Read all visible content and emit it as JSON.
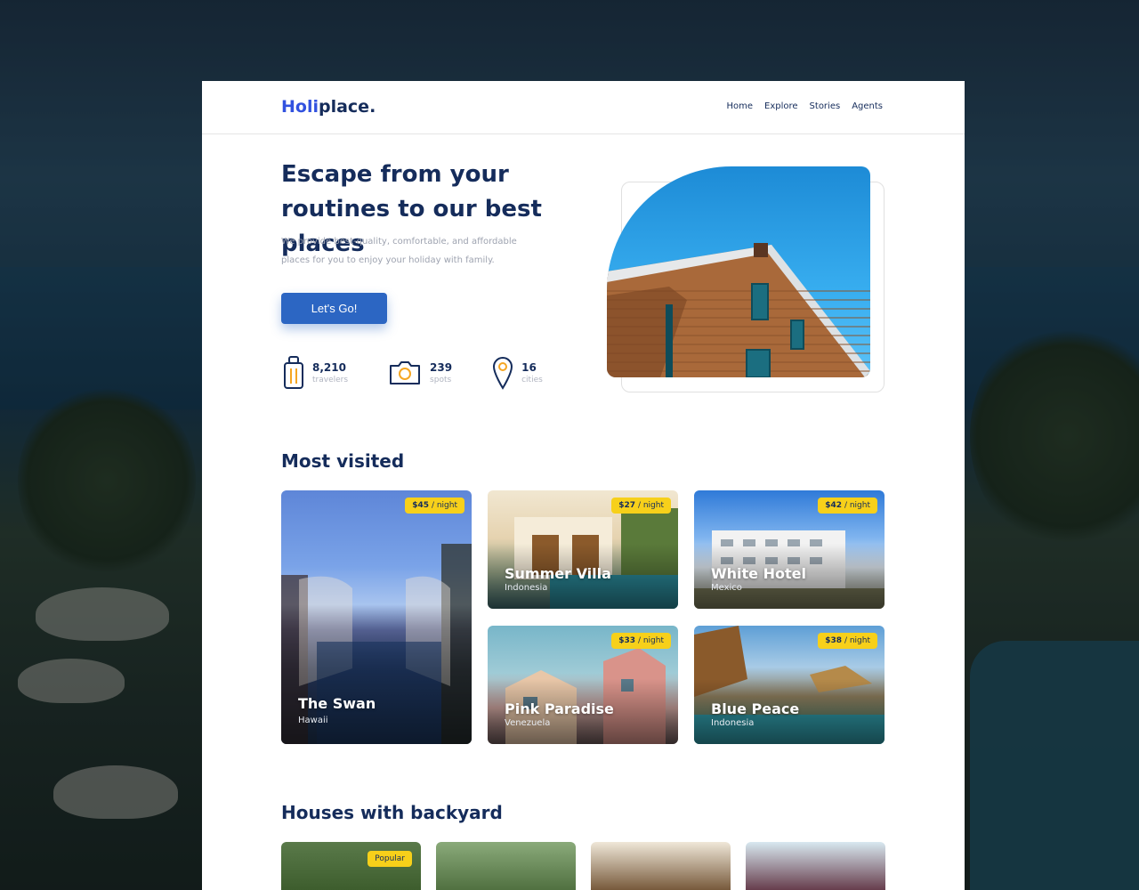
{
  "brand": {
    "name_part1": "Holi",
    "name_part2": "place."
  },
  "nav": {
    "items": [
      "Home",
      "Explore",
      "Stories",
      "Agents"
    ]
  },
  "hero": {
    "title": "Escape from your routines to our best places",
    "subtitle": "We provide best-quality, comfortable, and affordable places for you to enjoy your holiday with family.",
    "cta_label": "Let's Go!",
    "stats": [
      {
        "icon": "suitcase-icon",
        "value": "8,210",
        "label": "travelers"
      },
      {
        "icon": "camera-icon",
        "value": "239",
        "label": "spots"
      },
      {
        "icon": "map-pin-icon",
        "value": "16",
        "label": "cities"
      }
    ]
  },
  "most_visited": {
    "title": "Most visited",
    "cards": [
      {
        "name": "The Swan",
        "location": "Hawaii",
        "price": "$45",
        "unit": "/ night"
      },
      {
        "name": "Summer Villa",
        "location": "Indonesia",
        "price": "$27",
        "unit": "/ night"
      },
      {
        "name": "White Hotel",
        "location": "Mexico",
        "price": "$42",
        "unit": "/ night"
      },
      {
        "name": "Pink Paradise",
        "location": "Venezuela",
        "price": "$33",
        "unit": "/ night"
      },
      {
        "name": "Blue Peace",
        "location": "Indonesia",
        "price": "$38",
        "unit": "/ night"
      }
    ]
  },
  "houses": {
    "title": "Houses with backyard",
    "badge": "Popular"
  },
  "colors": {
    "primary": "#2c66c3",
    "navy": "#152c5b",
    "badge": "#f7d01a"
  }
}
